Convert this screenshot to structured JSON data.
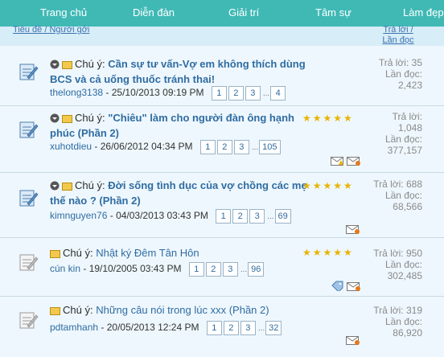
{
  "nav": {
    "items": [
      "Trang chủ",
      "Diễn đàn",
      "Giải trí",
      "Tâm sự",
      "Làm đẹp"
    ]
  },
  "columns": {
    "left": "Tiêu đề / Người gởi",
    "right": "Trả lời / Lần đọc"
  },
  "labels": {
    "note": "Chú ý:",
    "replies": "Trả lời:",
    "views": "Lần đọc:"
  },
  "threads": [
    {
      "title": "Cần sự tư vấn-Vợ em không thích dùng BCS và cả uống thuốc tránh thai!",
      "author": "thelong3138",
      "date": "- 25/10/2013 09:19 PM",
      "pages": [
        "1",
        "2",
        "3",
        "4"
      ],
      "replies": "35",
      "views": "2,423",
      "stars": 0
    },
    {
      "title": "\"Chiêu\" làm cho người đàn ông hạnh phúc (Phần 2)",
      "author": "xuhotdieu",
      "date": "- 26/06/2012 04:34 PM",
      "pages": [
        "1",
        "2",
        "3",
        "105"
      ],
      "replies": "1,048",
      "views": "377,157",
      "stars": 5
    },
    {
      "title": "Đời sống tình dục của vợ chồng các mẹ thế nào ? (Phần 2)",
      "author": "kimnguyen76",
      "date": "- 04/03/2013 03:43 PM",
      "pages": [
        "1",
        "2",
        "3",
        "69"
      ],
      "replies": "688",
      "views": "68,566",
      "stars": 5
    },
    {
      "title": "Nhật ký Đêm Tân Hôn",
      "author": "cún kin",
      "date": "- 19/10/2005 03:43 PM",
      "pages": [
        "1",
        "2",
        "3",
        "96"
      ],
      "replies": "950",
      "views": "302,485",
      "stars": 5
    },
    {
      "title": "Những câu nói trong lúc xxx (Phần 2)",
      "author": "pdtamhanh",
      "date": "- 20/05/2013 12:24 PM",
      "pages": [
        "1",
        "2",
        "3",
        "32"
      ],
      "replies": "319",
      "views": "86,920",
      "stars": 0
    }
  ],
  "colors": {
    "nav": "#40b9b5",
    "link": "#2f6ca2",
    "row": "#eef7fd",
    "stars": "#e8b400"
  }
}
